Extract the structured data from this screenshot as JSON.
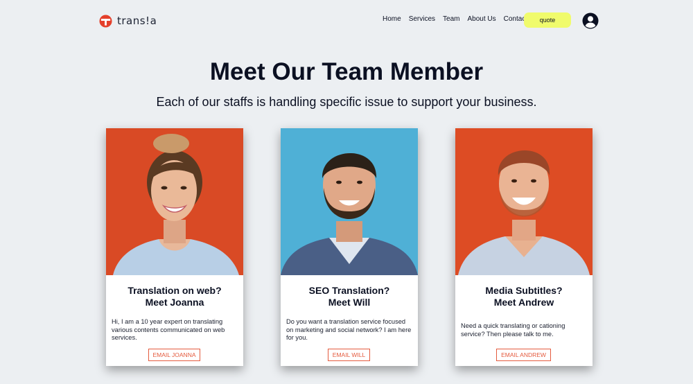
{
  "brand": {
    "name": "trans!a",
    "accent": "#e4402b"
  },
  "nav": {
    "items": [
      "Home",
      "Services",
      "Team",
      "About Us",
      "Contact"
    ],
    "quote_label": "quote",
    "quote_color": "#f0fb6c"
  },
  "hero": {
    "title": "Meet Our Team Member",
    "subtitle": "Each of our staffs is handling specific issue to support your business."
  },
  "team": [
    {
      "heading_line1": "Translation on web?",
      "heading_line2": "Meet Joanna",
      "description": "Hi, I am a 10 year expert on translating various contents communicated on web services.",
      "button": "EMAIL JOANNA",
      "photo_bg": "#d94a25"
    },
    {
      "heading_line1": "SEO Translation?",
      "heading_line2": "Meet Will",
      "description": "Do you want a translation service focused on marketing and social network? I am here for you.",
      "button": "EMAIL WILL",
      "photo_bg": "#4fb0d6"
    },
    {
      "heading_line1": "Media Subtitles?",
      "heading_line2": "Meet Andrew",
      "description": "Need a quick translating or cationing service? Then please talk to me.",
      "button": "EMAIL ANDREW",
      "photo_bg": "#dd4c24"
    }
  ],
  "colors": {
    "background": "#eceff2",
    "button_outline": "#e45a3d",
    "text": "#0b1022"
  }
}
